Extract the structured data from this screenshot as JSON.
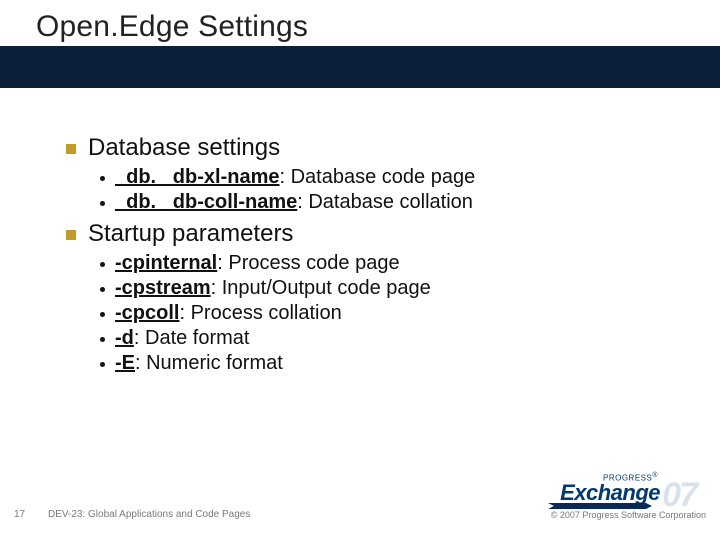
{
  "title": "Open.Edge Settings",
  "sections": [
    {
      "heading": "Database settings",
      "items": [
        {
          "bold": "_db. _db-xl-name",
          "rest": ": Database code page"
        },
        {
          "bold": "_db. _db-coll-name",
          "rest": ": Database collation"
        }
      ]
    },
    {
      "heading": "Startup parameters",
      "items": [
        {
          "bold": "-cpinternal",
          "rest": ": Process code page"
        },
        {
          "bold": "-cpstream",
          "rest": ": Input/Output code page"
        },
        {
          "bold": "-cpcoll",
          "rest": ": Process collation"
        },
        {
          "bold": "-d",
          "rest": ": Date format"
        },
        {
          "bold": "-E",
          "rest": ": Numeric format"
        }
      ]
    }
  ],
  "footer": {
    "page": "17",
    "session": "DEV-23: Global Applications and Code Pages",
    "copyright": "© 2007 Progress Software Corporation"
  },
  "logo": {
    "small": "PROGRESS",
    "reg": "®",
    "brand": "Exchange",
    "year": "07"
  }
}
